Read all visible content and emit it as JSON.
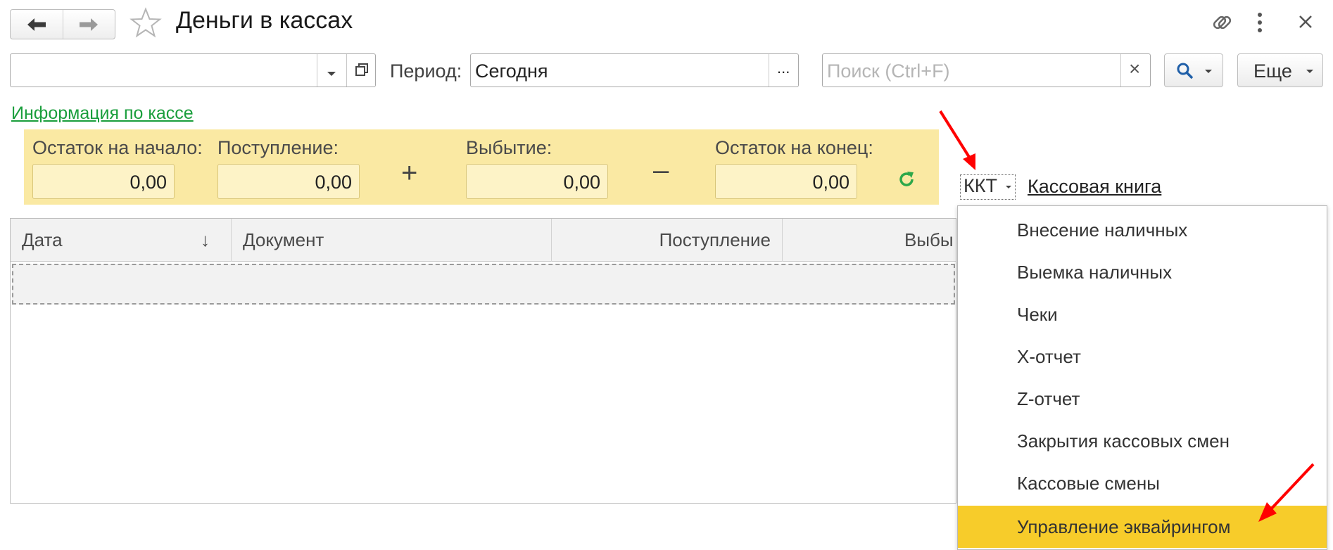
{
  "header": {
    "title": "Деньги в кассах"
  },
  "filters": {
    "period_label": "Период:",
    "period_value": "Сегодня",
    "period_pick_label": "...",
    "search_placeholder": "Поиск (Ctrl+F)",
    "search_clear": "×",
    "more_label": "Еще"
  },
  "info_link": "Информация по кассе",
  "summary": {
    "start_label": "Остаток на начало:",
    "start_value": "0,00",
    "income_label": "Поступление:",
    "income_value": "0,00",
    "plus": "+",
    "outflow_label": "Выбытие:",
    "outflow_value": "0,00",
    "minus": "–",
    "end_label": "Остаток на конец:",
    "end_value": "0,00"
  },
  "toolbar": {
    "kkt_label": "ККТ",
    "cashbook_label": "Кассовая книга"
  },
  "table": {
    "columns": [
      "Дата",
      "Документ",
      "Поступление",
      "Выбы"
    ],
    "sort_indicator": "↓"
  },
  "kkt_menu": {
    "items": [
      "Внесение наличных",
      "Выемка наличных",
      "Чеки",
      "X-отчет",
      "Z-отчет",
      "Закрытия кассовых смен",
      "Кассовые смены",
      "Управление эквайрингом"
    ],
    "selected": "Управление эквайрингом"
  },
  "colors": {
    "accent_yellow": "#f7cc2a",
    "panel_yellow": "#fae9a3",
    "link_green": "#1a9e3c",
    "annotation_red": "#ff0000"
  }
}
